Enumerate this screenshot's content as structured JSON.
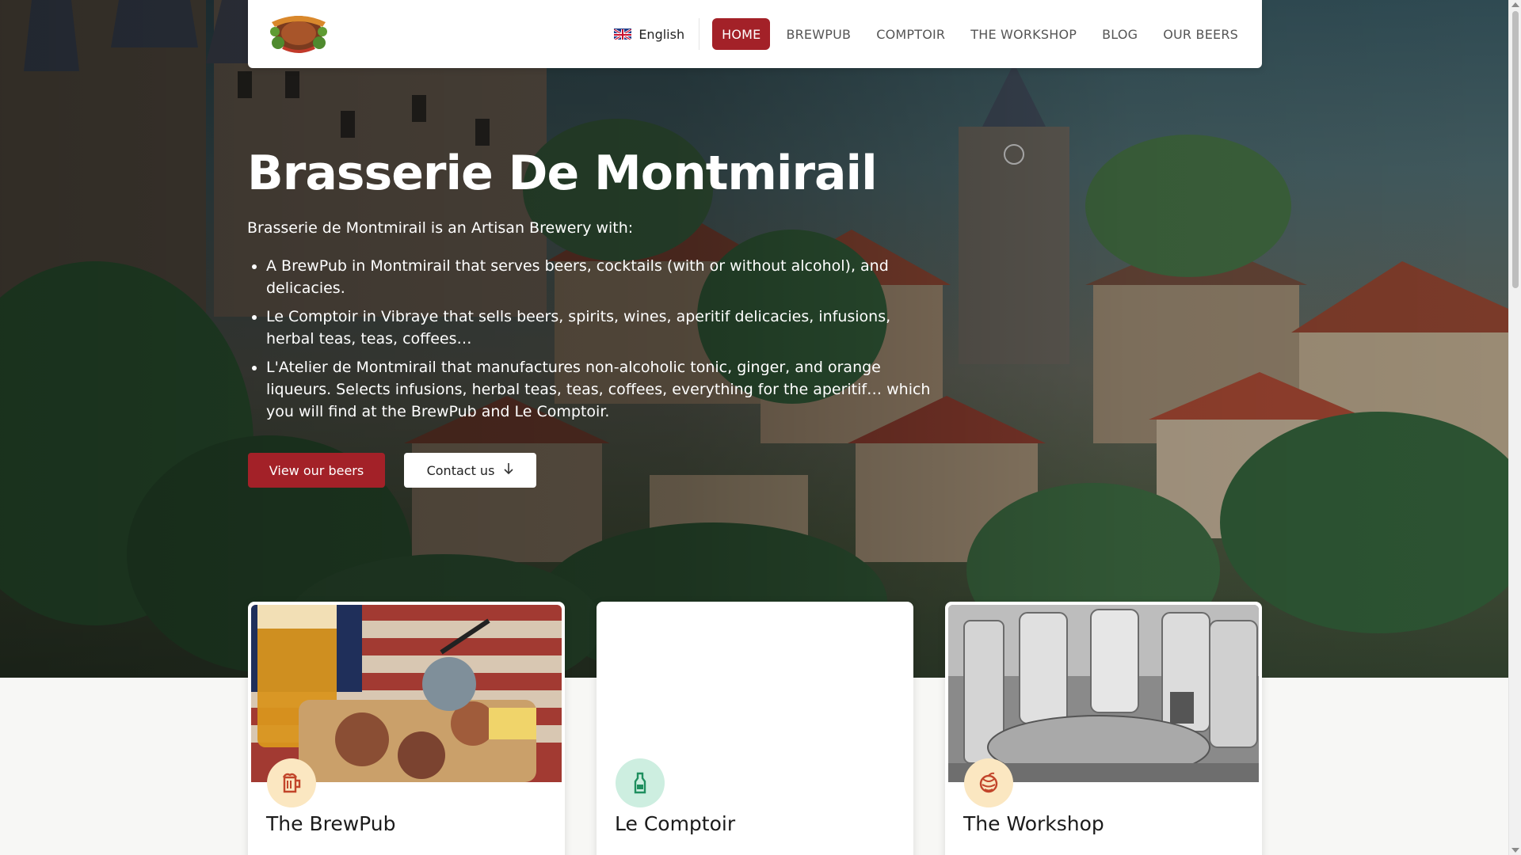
{
  "navbar": {
    "logo": "brewery-logo",
    "language": "English",
    "items": [
      {
        "label": "HOME",
        "active": true
      },
      {
        "label": "BREWPUB",
        "active": false
      },
      {
        "label": "COMPTOIR",
        "active": false
      },
      {
        "label": "THE WORKSHOP",
        "active": false
      },
      {
        "label": "BLOG",
        "active": false
      },
      {
        "label": "OUR BEERS",
        "active": false
      }
    ]
  },
  "hero": {
    "title": "Brasserie De Montmirail",
    "intro": "Brasserie de Montmirail is an Artisan Brewery with:",
    "items": [
      {
        "link": "A BrewPub",
        "text": " in Montmirail that serves beers, cocktails (with or without alcohol), and delicacies."
      },
      {
        "link": "Le Comptoir",
        "text": " in Vibraye that sells beers, spirits, wines, aperitif delicacies, infusions, herbal teas, teas, coffees…"
      },
      {
        "link": "L'Atelier",
        "text": " de Montmirail that manufactures non-alcoholic tonic, ginger, and orange liqueurs. Selects infusions, herbal teas, teas, coffees, everything for the aperitif… which you will find at the BrewPub and Le Comptoir."
      }
    ],
    "buttons": {
      "primary": "View our beers",
      "secondary": "Contact us"
    }
  },
  "cards": [
    {
      "title": "The BrewPub",
      "icon": "beer-mug-icon",
      "icon_bg": "#fbe7c1",
      "icon_color": "#c2452a"
    },
    {
      "title": "Le Comptoir",
      "icon": "bottle-icon",
      "icon_bg": "#cdeee0",
      "icon_color": "#1f8f5f"
    },
    {
      "title": "The Workshop",
      "icon": "hops-icon",
      "icon_bg": "#fbe7c1",
      "icon_color": "#c2452a"
    }
  ],
  "colors": {
    "accent": "#a32128",
    "highlight_brewpub": "#c4432a",
    "highlight_comptoir": "#2aa574",
    "highlight_atelier": "#d17a1c"
  }
}
